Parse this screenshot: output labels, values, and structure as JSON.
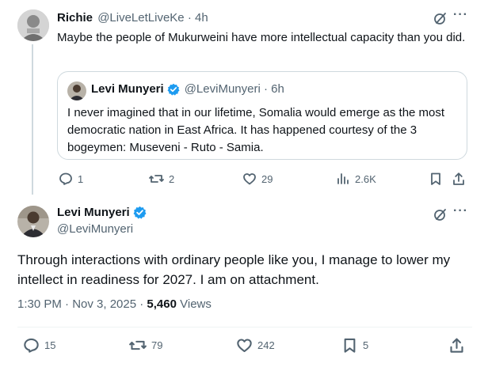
{
  "reply": {
    "author_name": "Richie",
    "handle_time": "@LiveLetLiveKe · 4h",
    "text": "Maybe the people of Mukurweini have more intellectual capacity than you did.",
    "quote": {
      "author_name": "Levi Munyeri",
      "handle_time": "@LeviMunyeri · 6h",
      "text": "I never imagined that in our lifetime, Somalia would emerge as the most democratic nation in East Africa. It has happened courtesy of the 3 bogeymen: Museveni - Ruto - Samia."
    },
    "actions": {
      "replies": "1",
      "reposts": "2",
      "likes": "29",
      "views": "2.6K"
    }
  },
  "main": {
    "author_name": "Levi Munyeri",
    "handle": "@LeviMunyeri",
    "text": "Through interactions with ordinary people like you, I manage to lower my intellect in readiness for 2027. I am on attachment.",
    "timestamp": "1:30 PM · Nov 3, 2025 · ",
    "views_count": "5,460",
    "views_label": " Views",
    "actions": {
      "replies": "15",
      "reposts": "79",
      "likes": "242",
      "bookmarks": "5"
    }
  },
  "colors": {
    "verified": "#1d9bf0",
    "text": "#0f1419",
    "secondary": "#536471",
    "border": "#cfd9de"
  }
}
